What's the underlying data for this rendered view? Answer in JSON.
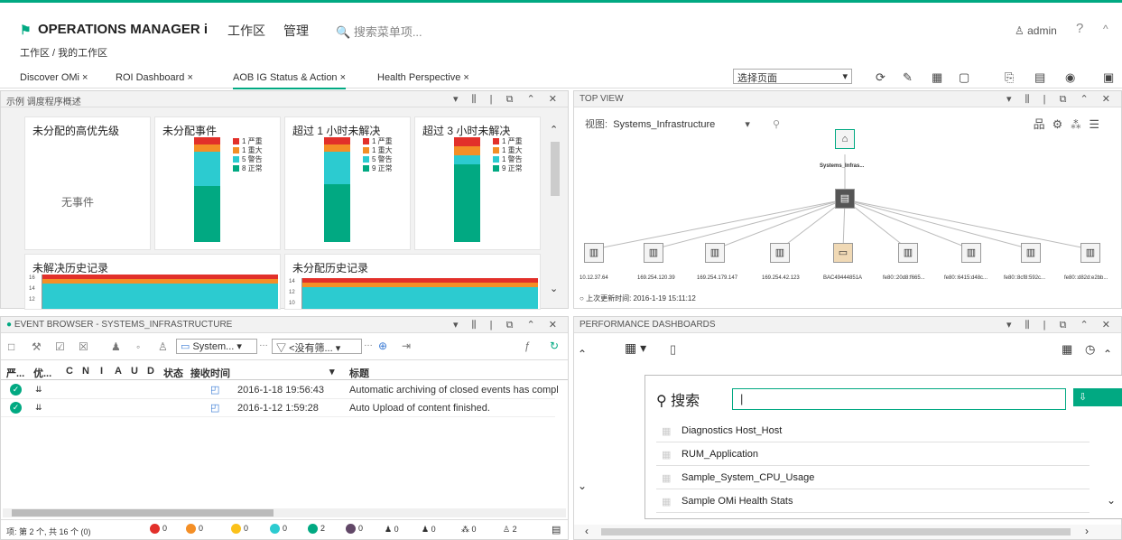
{
  "app": {
    "title": "OPERATIONS MANAGER i",
    "nav_workspace": "工作区",
    "nav_admin": "管理",
    "search_placeholder": "搜索菜单项...",
    "user": "admin",
    "help": "?",
    "collapse": "^"
  },
  "breadcrumb": "工作区 / 我的工作区",
  "tabs": [
    {
      "label": "Discover OMi ×"
    },
    {
      "label": "ROI Dashboard ×"
    },
    {
      "label": "AOB IG Status & Action ×"
    },
    {
      "label": "Health Perspective ×"
    }
  ],
  "page_select": "选择页面",
  "overview": {
    "title": "示例 调度程序概述",
    "card1": {
      "title": "未分配的高优先级",
      "empty": "无事件"
    },
    "card2": {
      "title": "未分配事件",
      "legend": [
        "1 严重",
        "1 重大",
        "5 警告",
        "8 正常"
      ],
      "values": [
        1,
        1,
        5,
        8
      ]
    },
    "card3": {
      "title": "超过 1 小时未解决",
      "legend": [
        "1 严重",
        "1 重大",
        "5 警告",
        "9 正常"
      ],
      "values": [
        1,
        1,
        5,
        9
      ]
    },
    "card4": {
      "title": "超过 3 小时未解决",
      "legend": [
        "1 严重",
        "1 重大",
        "1 警告",
        "9 正常"
      ],
      "values": [
        1,
        1,
        1,
        9
      ]
    },
    "hist1": {
      "title": "未解决历史记录",
      "ticks": [
        "16",
        "14",
        "12"
      ]
    },
    "hist2": {
      "title": "未分配历史记录",
      "ticks": [
        "14",
        "12",
        "10"
      ]
    }
  },
  "topview": {
    "title": "TOP VIEW",
    "view_label": "视图:",
    "view_value": "Systems_Infrastructure",
    "root_label": "Systems_Infras...",
    "nodes": [
      "10.12.37.64",
      "169.254.120.39",
      "169.254.179.147",
      "169.254.42.123",
      "BAC49444851A",
      "fe80::20d8:f665...",
      "fe80::6415:d48c...",
      "fe80::8cf8:592c...",
      "fe80::d82d:e2bb..."
    ],
    "updated": "上次更新时间: 2016-1-19 15:11:12"
  },
  "events": {
    "title": "EVENT BROWSER - SYSTEMS_INFRASTRUCTURE",
    "filter_view": "System...",
    "filter_none": "<没有筛...",
    "columns": [
      "严...",
      "优...",
      "C",
      "N",
      "I",
      "A",
      "U",
      "D",
      "状态",
      "接收时间",
      "标题"
    ],
    "rows": [
      {
        "time": "2016-1-18 19:56:43",
        "title": "Automatic archiving of closed events has compl"
      },
      {
        "time": "2016-1-12 1:59:28",
        "title": "Auto Upload of content finished."
      }
    ],
    "status_text": "项: 第 2 个, 共 16 个 (0)",
    "counts": [
      "0",
      "0",
      "0",
      "0",
      "2",
      "0",
      "0",
      "0",
      "0",
      "2"
    ],
    "colors": {
      "critical": "#e2302a",
      "major": "#f48f26",
      "minor": "#fbc11a",
      "warning": "#2ccbd0",
      "normal": "#01a982",
      "unknown": "#614767"
    }
  },
  "perf": {
    "title": "PERFORMANCE DASHBOARDS",
    "search_label": "搜索",
    "search_value": "|",
    "items": [
      "Diagnostics Host_Host",
      "RUM_Application",
      "Sample_System_CPU_Usage",
      "Sample OMi Health Stats"
    ]
  }
}
